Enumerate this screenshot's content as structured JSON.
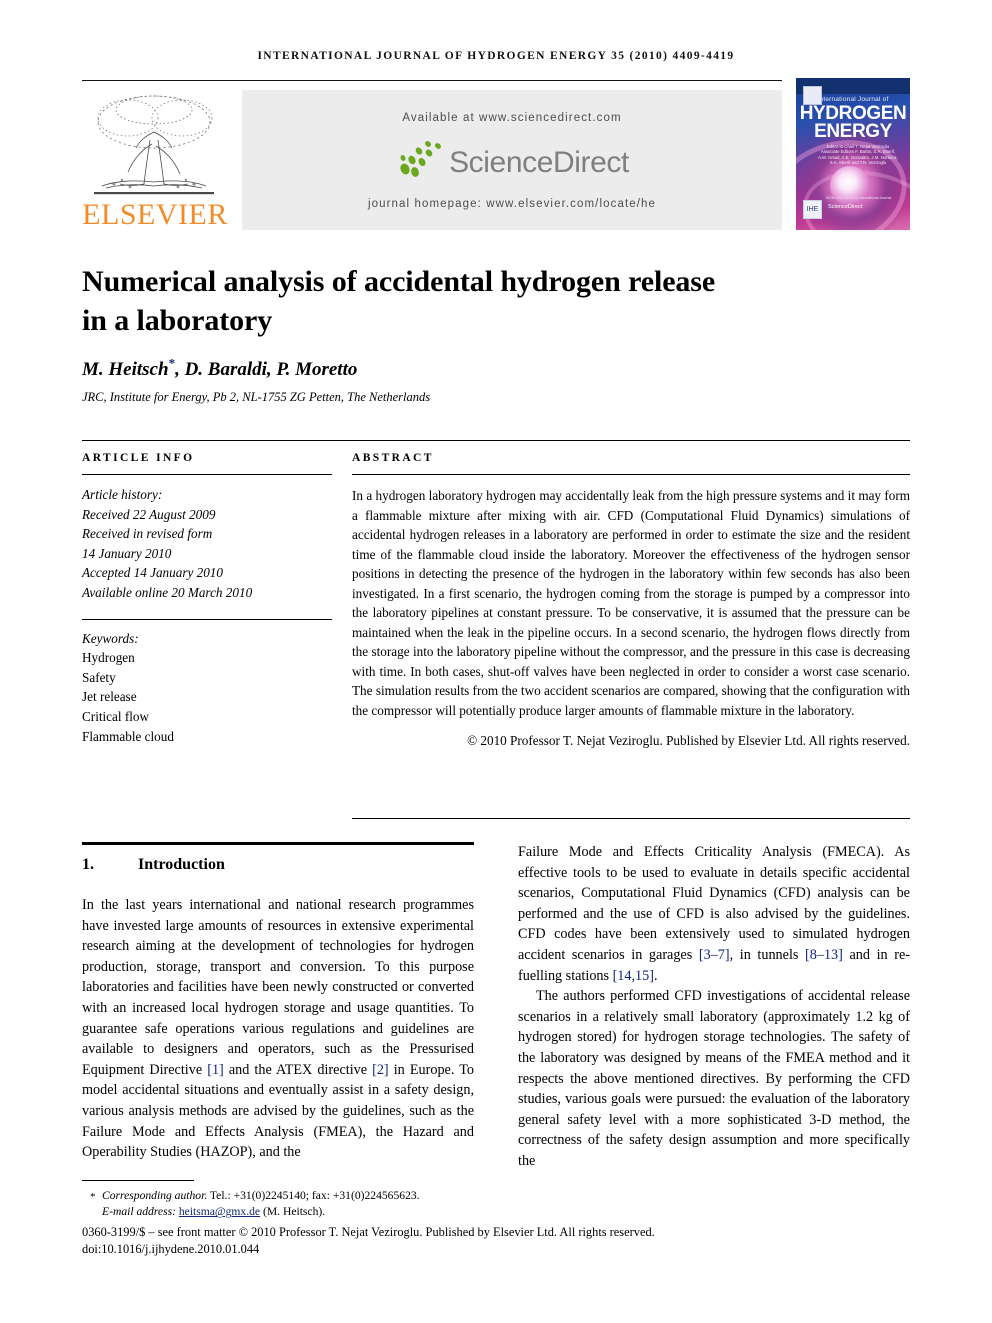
{
  "running_head": "INTERNATIONAL JOURNAL OF HYDROGEN ENERGY 35 (2010) 4409-4419",
  "masthead": {
    "elsevier_wordmark": "ELSEVIER",
    "available_at": "Available at www.sciencedirect.com",
    "sciencedirect_wordmark": "ScienceDirect",
    "journal_homepage": "journal homepage: www.elsevier.com/locate/he",
    "cover": {
      "line_small": "International Journal of",
      "line_hydrogen": "HYDROGEN",
      "line_energy": "ENERGY",
      "editors": "Editor-in-Chief  T. Nejat Veziroglu    Associate Editors  F. Barbir, S.A. Sherif, A.M. Ismail, A.E. Gonzalez, J.M. Norbeck, S.A. Sherif and T.N. Veziroglu",
      "issn_line": "ISSN 0360-3199  An International Journal",
      "sciencedirect": "ScienceDirect",
      "badge_label": "IHE"
    }
  },
  "article": {
    "title_line1": "Numerical analysis of accidental hydrogen release",
    "title_line2": "in a laboratory",
    "authors": "M. Heitsch, D. Baraldi, P. Moretto",
    "author_marker": "*",
    "affiliation": "JRC, Institute for Energy, Pb 2, NL-1755 ZG Petten, The Netherlands"
  },
  "info": {
    "heading": "ARTICLE INFO",
    "history_label": "Article history:",
    "history": [
      "Received 22 August 2009",
      "Received in revised form",
      "14 January 2010",
      "Accepted 14 January 2010",
      "Available online 20 March 2010"
    ],
    "keywords_label": "Keywords:",
    "keywords": [
      "Hydrogen",
      "Safety",
      "Jet release",
      "Critical flow",
      "Flammable cloud"
    ]
  },
  "abstract": {
    "heading": "ABSTRACT",
    "text": "In a hydrogen laboratory hydrogen may accidentally leak from the high pressure systems and it may form a flammable mixture after mixing with air. CFD (Computational Fluid Dynamics) simulations of accidental hydrogen releases in a laboratory are performed in order to estimate the size and the resident time of the flammable cloud inside the laboratory. Moreover the effectiveness of the hydrogen sensor positions in detecting the presence of the hydrogen in the laboratory within few seconds has also been investigated. In a first scenario, the hydrogen coming from the storage is pumped by a compressor into the laboratory pipelines at constant pressure. To be conservative, it is assumed that the pressure can be maintained when the leak in the pipeline occurs. In a second scenario, the hydrogen flows directly from the storage into the laboratory pipeline without the compressor, and the pressure in this case is decreasing with time. In both cases, shut-off valves have been neglected in order to consider a worst case scenario. The simulation results from the two accident scenarios are compared, showing that the configuration with the compressor will potentially produce larger amounts of flammable mixture in the laboratory.",
    "copyright": "© 2010 Professor T. Nejat Veziroglu. Published by Elsevier Ltd. All rights reserved."
  },
  "section": {
    "number": "1.",
    "title": "Introduction"
  },
  "body": {
    "left_p1_a": "In the last years international and national research programmes have invested large amounts of resources in extensive experimental research aiming at the development of technologies for hydrogen production, storage, transport and conversion. To this purpose laboratories and facilities have been newly constructed or converted with an increased local hydrogen storage and usage quantities. To guarantee safe operations various regulations and guidelines are available to designers and operators, such as the Pressurised Equipment Directive ",
    "left_ref1": "[1]",
    "left_p1_b": " and the ATEX directive ",
    "left_ref2": "[2]",
    "left_p1_c": " in Europe. To model accidental situations and eventually assist in a safety design, various analysis methods are advised by the guidelines, such as the Failure Mode and Effects Analysis (FMEA), the Hazard and Operability Studies (HAZOP), and the",
    "right_p1_a": "Failure Mode and Effects Criticality Analysis (FMECA). As effective tools to be used to evaluate in details specific accidental scenarios, Computational Fluid Dynamics (CFD) analysis can be performed and the use of CFD is also advised by the guidelines. CFD codes have been extensively used to simulated hydrogen accident scenarios in garages ",
    "right_ref1": "[3–7]",
    "right_p1_b": ", in tunnels ",
    "right_ref2": "[8–13]",
    "right_p1_c": " and in re-fuelling stations ",
    "right_ref3": "[14,15]",
    "right_p1_d": ".",
    "right_p2": "The authors performed CFD investigations of accidental release scenarios in a relatively small laboratory (approximately 1.2 kg of hydrogen stored) for hydrogen storage technologies. The safety of the laboratory was designed by means of the FMEA method and it respects the above mentioned directives. By performing the CFD studies, various goals were pursued: the evaluation of the laboratory general safety level with a more sophisticated 3-D method, the correctness of the safety design assumption and more specifically the"
  },
  "footer": {
    "corresponding_marker": "*",
    "corresponding_label": "Corresponding author.",
    "corresponding_contact": " Tel.: +31(0)2245140; fax: +31(0)224565623.",
    "email_label": "E-mail address:",
    "email": "heitsma@gmx.de",
    "email_owner": "(M. Heitsch).",
    "frontmatter": "0360-3199/$ – see front matter © 2010 Professor T. Nejat Veziroglu. Published by Elsevier Ltd. All rights reserved.",
    "doi": "doi:10.1016/j.ijhydene.2010.01.044"
  },
  "colors": {
    "elsevier_orange": "#F28C28",
    "link_blue": "#12257a",
    "sciencedirect_green": "#6aa81f",
    "sciencedirect_gray": "#7f7f7f",
    "panel_gray": "#ececec",
    "cover_blue": "#1c3f9b",
    "cover_magenta": "#c23b93"
  }
}
